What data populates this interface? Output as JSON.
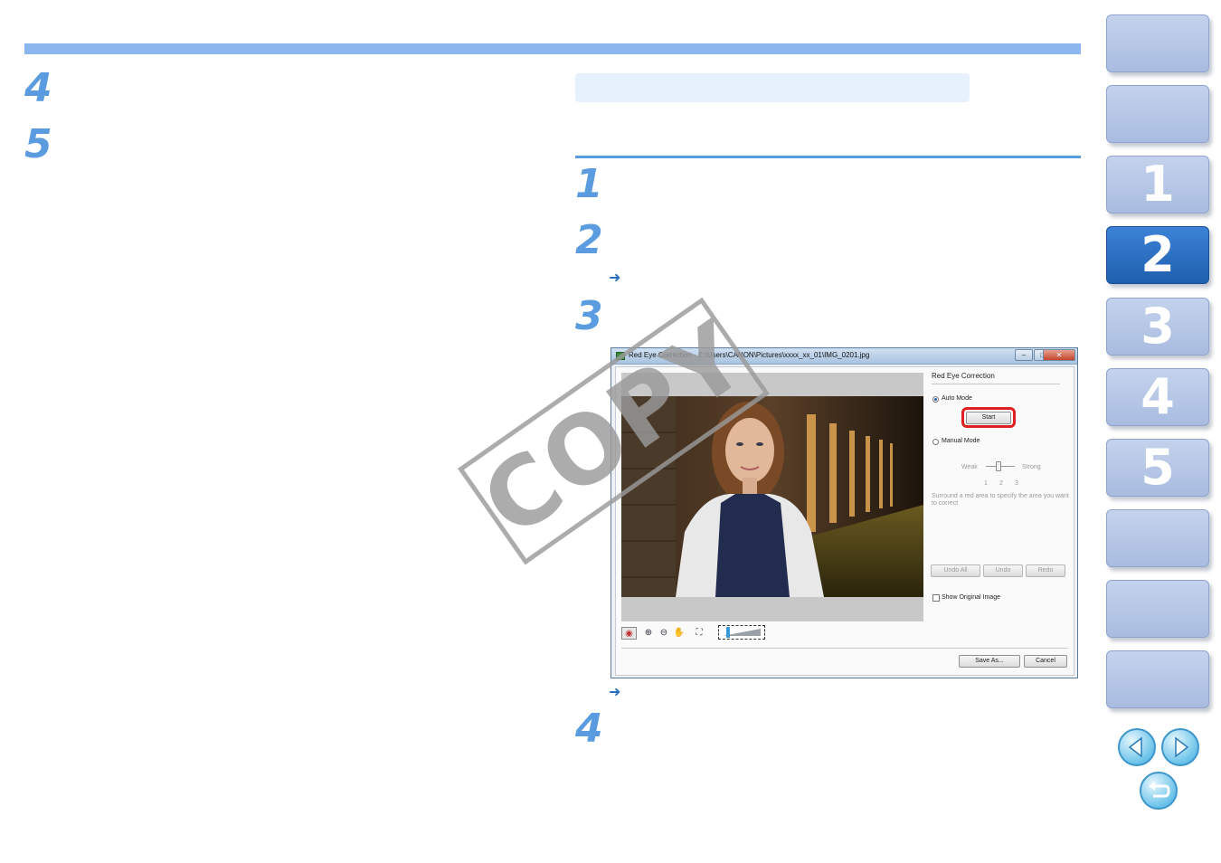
{
  "left_steps": [
    "4",
    "5"
  ],
  "right_steps": [
    "1",
    "2",
    "3",
    "4"
  ],
  "arrows": [
    "➜",
    "➜"
  ],
  "watermark": "COPY",
  "dialog": {
    "title": "Red Eye Correction - E:\\Users\\CANON\\Pictures\\xxxx_xx_01\\IMG_0201.jpg",
    "window_controls": [
      "–",
      "□",
      "✕"
    ],
    "panel_title": "Red Eye Correction",
    "auto_mode_label": "Auto Mode",
    "start_label": "Start",
    "manual_mode_label": "Manual Mode",
    "weak_label": "Weak",
    "strong_label": "Strong",
    "ticks": [
      "1",
      "2",
      "3"
    ],
    "instruction": "Surround a red area to specify the area you want to correct",
    "undo_all_label": "Undo All",
    "undo_label": "Undo",
    "redo_label": "Redo",
    "show_original_label": "Show Original Image",
    "save_as_label": "Save As...",
    "cancel_label": "Cancel"
  },
  "nav_tabs": [
    "",
    "",
    "1",
    "2",
    "3",
    "4",
    "5",
    "",
    "",
    ""
  ],
  "active_tab": "2",
  "colors": {
    "accent": "#5b9ce0",
    "rule": "#8bb6ee",
    "active_tab": "#2a6fc4",
    "highlight_ring": "#e02020"
  }
}
